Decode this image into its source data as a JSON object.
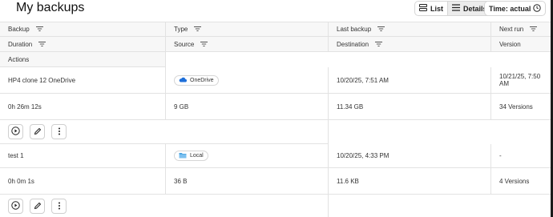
{
  "page": {
    "title": "My backups"
  },
  "view_toggle": {
    "list_label": "List",
    "details_label": "Details",
    "active": "Details"
  },
  "time_button": {
    "label": "Time: actual",
    "icon": "clock-icon"
  },
  "columns": {
    "backup": "Backup",
    "type": "Type",
    "last_backup": "Last backup",
    "next_run": "Next run",
    "duration": "Duration",
    "source": "Source",
    "destination": "Destination",
    "version": "Version",
    "actions": "Actions"
  },
  "backups": [
    {
      "name": "HP4 clone 12 OneDrive",
      "type": "OneDrive",
      "type_icon": "cloud-icon",
      "type_icon_color": "#1e6fd9",
      "last_backup": "10/20/25, 7:51 AM",
      "next_run": "10/21/25, 7:50 AM",
      "duration": "0h 26m 12s",
      "source": "9 GB",
      "destination": "11.34 GB",
      "version": "34 Versions"
    },
    {
      "name": "test 1",
      "type": "Local",
      "type_icon": "folder-icon",
      "type_icon_color": "#4aa3e0",
      "last_backup": "10/20/25, 4:33 PM",
      "next_run": "-",
      "duration": "0h 0m 1s",
      "source": "36 B",
      "destination": "11.6 KB",
      "version": "4 Versions"
    }
  ]
}
